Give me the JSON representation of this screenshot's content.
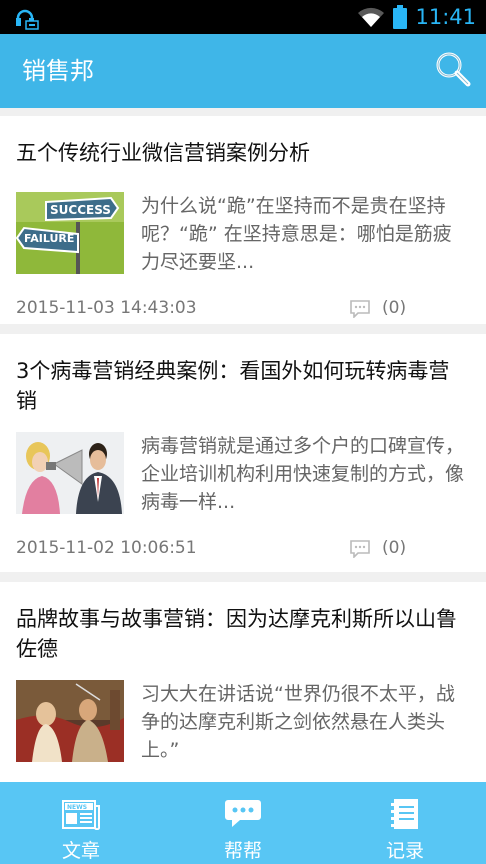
{
  "status": {
    "time": "11:41"
  },
  "app": {
    "title": "销售邦"
  },
  "articles": [
    {
      "title": "五个传统行业微信营销案例分析",
      "summary": "为什么说“跪”在坚持而不是贵在坚持呢？“跪” 在坚持意思是：哪怕是筋疲力尽还要坚...",
      "date": "2015-11-03 14:43:03",
      "comments": "(0)",
      "thumb_text": [
        "SUCCESS",
        "FAILURE"
      ]
    },
    {
      "title": "3个病毒营销经典案例：看国外如何玩转病毒营销",
      "summary": "病毒营销就是通过多个户的口碑宣传，企业培训机构利用快速复制的方式，像病毒一样...",
      "date": "2015-11-02 10:06:51",
      "comments": "(0)"
    },
    {
      "title": "品牌故事与故事营销：因为达摩克利斯所以山鲁佐德",
      "summary": "习大大在讲话说“世界仍很不太平，战争的达摩克利斯之剑依然悬在人类头上。”"
    }
  ],
  "nav": {
    "items": [
      {
        "label": "文章",
        "icon": "news-icon"
      },
      {
        "label": "帮帮",
        "icon": "chat-icon"
      },
      {
        "label": "记录",
        "icon": "notebook-icon"
      }
    ]
  },
  "colors": {
    "appbar": "#3fb6e8",
    "bottomnav": "#58c6f4",
    "time": "#29b6f6"
  }
}
